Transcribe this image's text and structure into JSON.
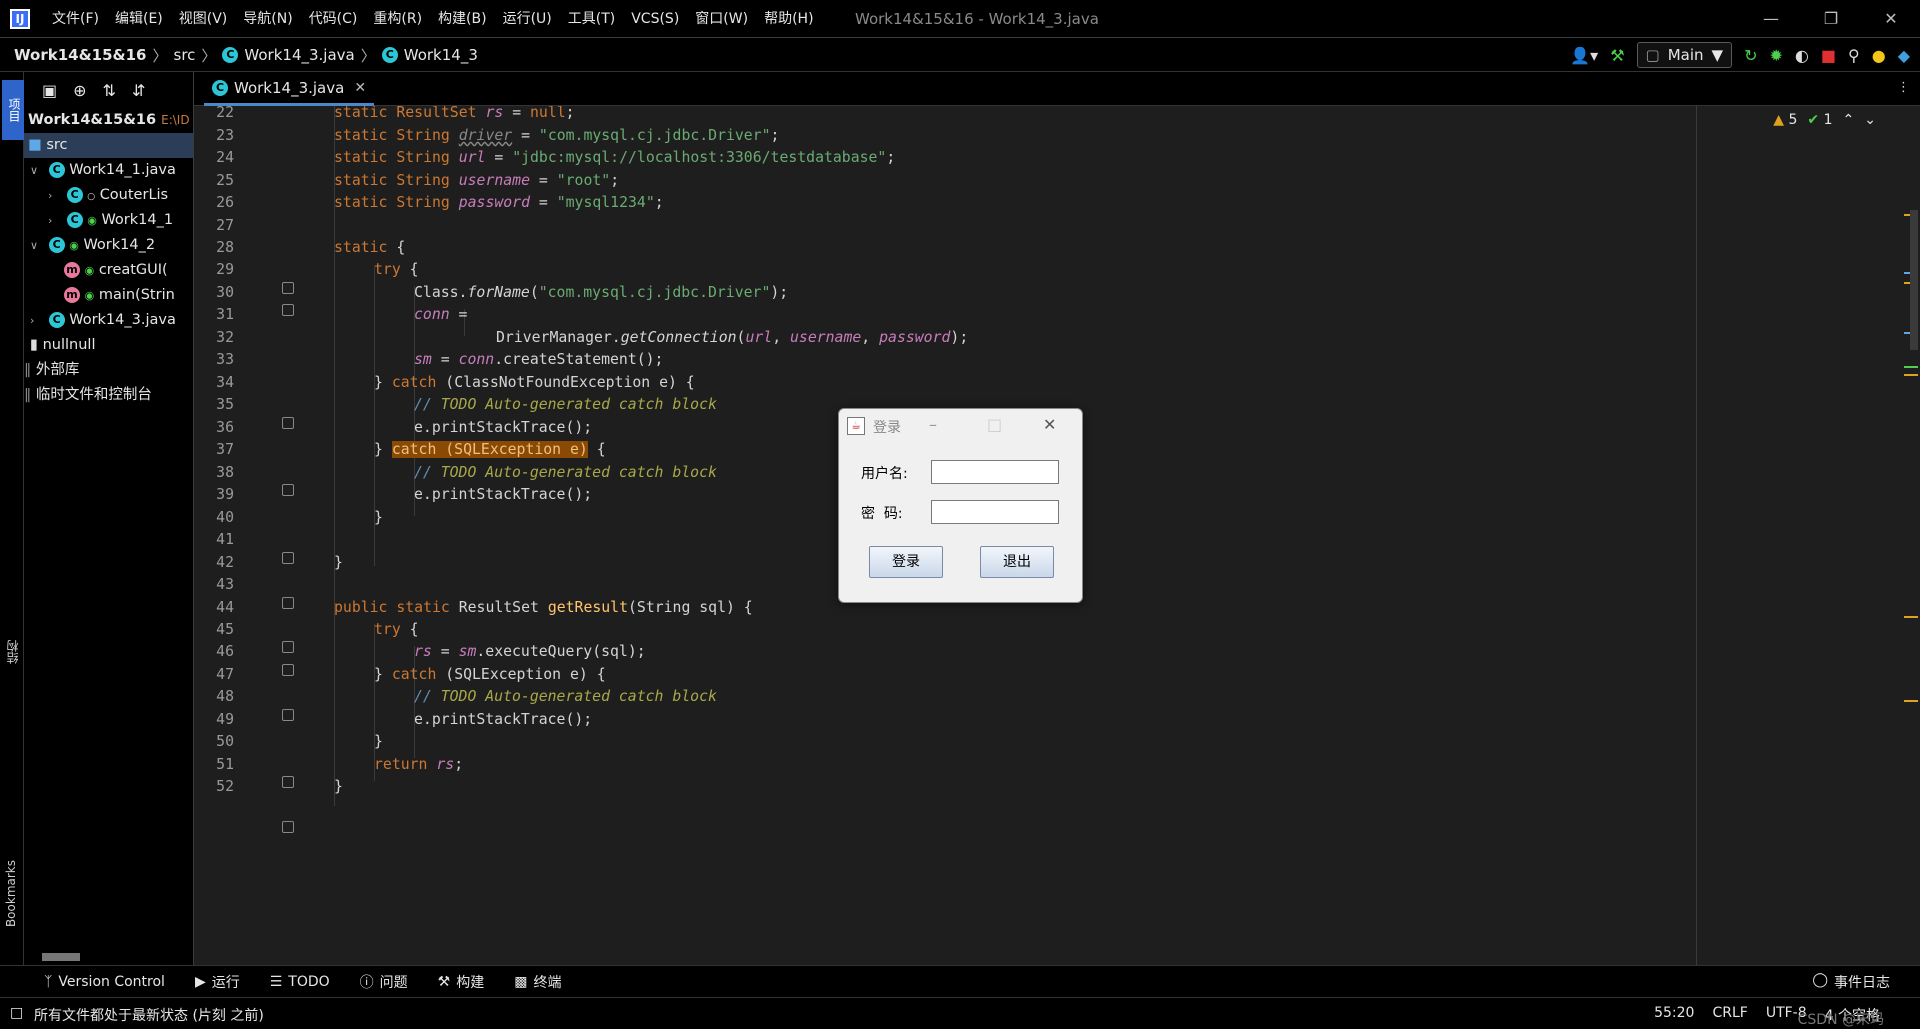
{
  "app": {
    "menu": [
      "文件(F)",
      "编辑(E)",
      "视图(V)",
      "导航(N)",
      "代码(C)",
      "重构(R)",
      "构建(B)",
      "运行(U)",
      "工具(T)",
      "VCS(S)",
      "窗口(W)",
      "帮助(H)"
    ],
    "window_title": "Work14&15&16 - Work14_3.java",
    "app_icon_letter": "IJ"
  },
  "breadcrumb": {
    "project": "Work14&15&16",
    "folder": "src",
    "file": "Work14_3.java",
    "class": "Work14_3"
  },
  "toolbar": {
    "run_config": "Main"
  },
  "left_strip": {
    "project_label": "项目",
    "structure_label": "结构",
    "bookmarks_label": "Bookmarks"
  },
  "project_tree": {
    "root_name": "Work14&15&16",
    "root_path": "E:\\ID",
    "items": [
      {
        "label": "src",
        "kind": "folder"
      },
      {
        "label": "Work14_1.java",
        "kind": "class"
      },
      {
        "label": "CouterLis",
        "kind": "class"
      },
      {
        "label": "Work14_1",
        "kind": "class"
      },
      {
        "label": "Work14_2",
        "kind": "class"
      },
      {
        "label": "creatGUI(",
        "kind": "method"
      },
      {
        "label": "main(Strin",
        "kind": "method"
      },
      {
        "label": "Work14_3.java",
        "kind": "class"
      },
      {
        "label": "nullnull",
        "kind": "file"
      },
      {
        "label": "外部库",
        "kind": "lib"
      },
      {
        "label": "临时文件和控制台",
        "kind": "scratch"
      }
    ]
  },
  "editor": {
    "tab_label": "Work14_3.java",
    "inspections": {
      "warnings": "5",
      "ok": "1"
    },
    "line_numbers": [
      "22",
      "23",
      "24",
      "25",
      "26",
      "27",
      "28",
      "29",
      "30",
      "31",
      "32",
      "33",
      "34",
      "35",
      "36",
      "37",
      "38",
      "39",
      "40",
      "41",
      "42",
      "43",
      "44",
      "45",
      "46",
      "47",
      "48",
      "49",
      "50",
      "51",
      "52"
    ],
    "code": {
      "l22": {
        "a": "static ResultSet ",
        "b": "rs",
        "c": " = ",
        "d": "null",
        "e": ";"
      },
      "l23": {
        "a": "static String ",
        "b": "driver",
        "c": " = ",
        "d": "\"com.mysql.cj.jdbc.Driver\"",
        "e": ";"
      },
      "l24": {
        "a": "static String ",
        "b": "url",
        "c": " = ",
        "d": "\"jdbc:mysql://localhost:3306/testdatabase\"",
        "e": ";"
      },
      "l25": {
        "a": "static String ",
        "b": "username",
        "c": " = ",
        "d": "\"root\"",
        "e": ";"
      },
      "l26": {
        "a": "static String ",
        "b": "password",
        "c": " = ",
        "d": "\"mysql1234\"",
        "e": ";"
      },
      "l28": {
        "a": "static",
        "b": " {"
      },
      "l29": {
        "a": "try",
        "b": " {"
      },
      "l30": {
        "a": "Class.",
        "b": "forName",
        "c": "(",
        "d": "\"com.mysql.cj.jdbc.Driver\"",
        "e": ");"
      },
      "l31": {
        "a": "conn",
        "b": " ="
      },
      "l32": {
        "a": "DriverManager.",
        "b": "getConnection",
        "c": "(",
        "d": "url",
        "e": ", ",
        "f": "username",
        "g": ", ",
        "h": "password",
        "i": ");"
      },
      "l33": {
        "a": "sm",
        "b": " = ",
        "c": "conn",
        "d": ".createStatement();"
      },
      "l34": {
        "a": "} ",
        "b": "catch",
        "c": " (ClassNotFoundException e) {"
      },
      "l35": {
        "a": "// ",
        "b": "TODO Auto-generated catch block"
      },
      "l36": {
        "a": "e.printStackTrace();"
      },
      "l37": {
        "a": "} ",
        "b": "catch (SQLException e)",
        "c": " {"
      },
      "l38": {
        "a": "// ",
        "b": "TODO Auto-generated catch block"
      },
      "l39": {
        "a": "e.printStackTrace();"
      },
      "l40": {
        "a": "}"
      },
      "l42": {
        "a": "}"
      },
      "l44": {
        "a": "public static ",
        "b": "ResultSet ",
        "c": "getResult",
        "d": "(String sql) {"
      },
      "l45": {
        "a": "try",
        "b": " {"
      },
      "l46": {
        "a": "rs",
        "b": " = ",
        "c": "sm",
        "d": ".executeQuery(sql);"
      },
      "l47": {
        "a": "} ",
        "b": "catch",
        "c": " (SQLException e) {"
      },
      "l48": {
        "a": "// ",
        "b": "TODO Auto-generated catch block"
      },
      "l49": {
        "a": "e.printStackTrace();"
      },
      "l50": {
        "a": "}"
      },
      "l51": {
        "a": "return ",
        "b": "rs",
        "c": ";"
      },
      "l52": {
        "a": "}"
      }
    }
  },
  "login_dialog": {
    "title": "登录",
    "username_label": "用户名:",
    "password_label": "密  码:",
    "username_value": "",
    "password_value": "",
    "login_button": "登录",
    "exit_button": "退出"
  },
  "tool_windows": {
    "version_control": "Version Control",
    "run": "运行",
    "todo": "TODO",
    "problems": "问题",
    "build": "构建",
    "terminal": "终端",
    "event_log": "事件日志"
  },
  "status_bar": {
    "message": "所有文件都处于最新状态 (片刻 之前)",
    "position": "55:20",
    "line_sep": "CRLF",
    "encoding": "UTF-8",
    "indent": "4 个空格",
    "watermark": "CSDN @宋玛"
  },
  "colors": {
    "keyword": "#cc7832",
    "string": "#6aab73",
    "field": "#c77dbb",
    "comment": "#5f8fb8",
    "highlight": "#8a4a04",
    "accent": "#2f65ca"
  }
}
